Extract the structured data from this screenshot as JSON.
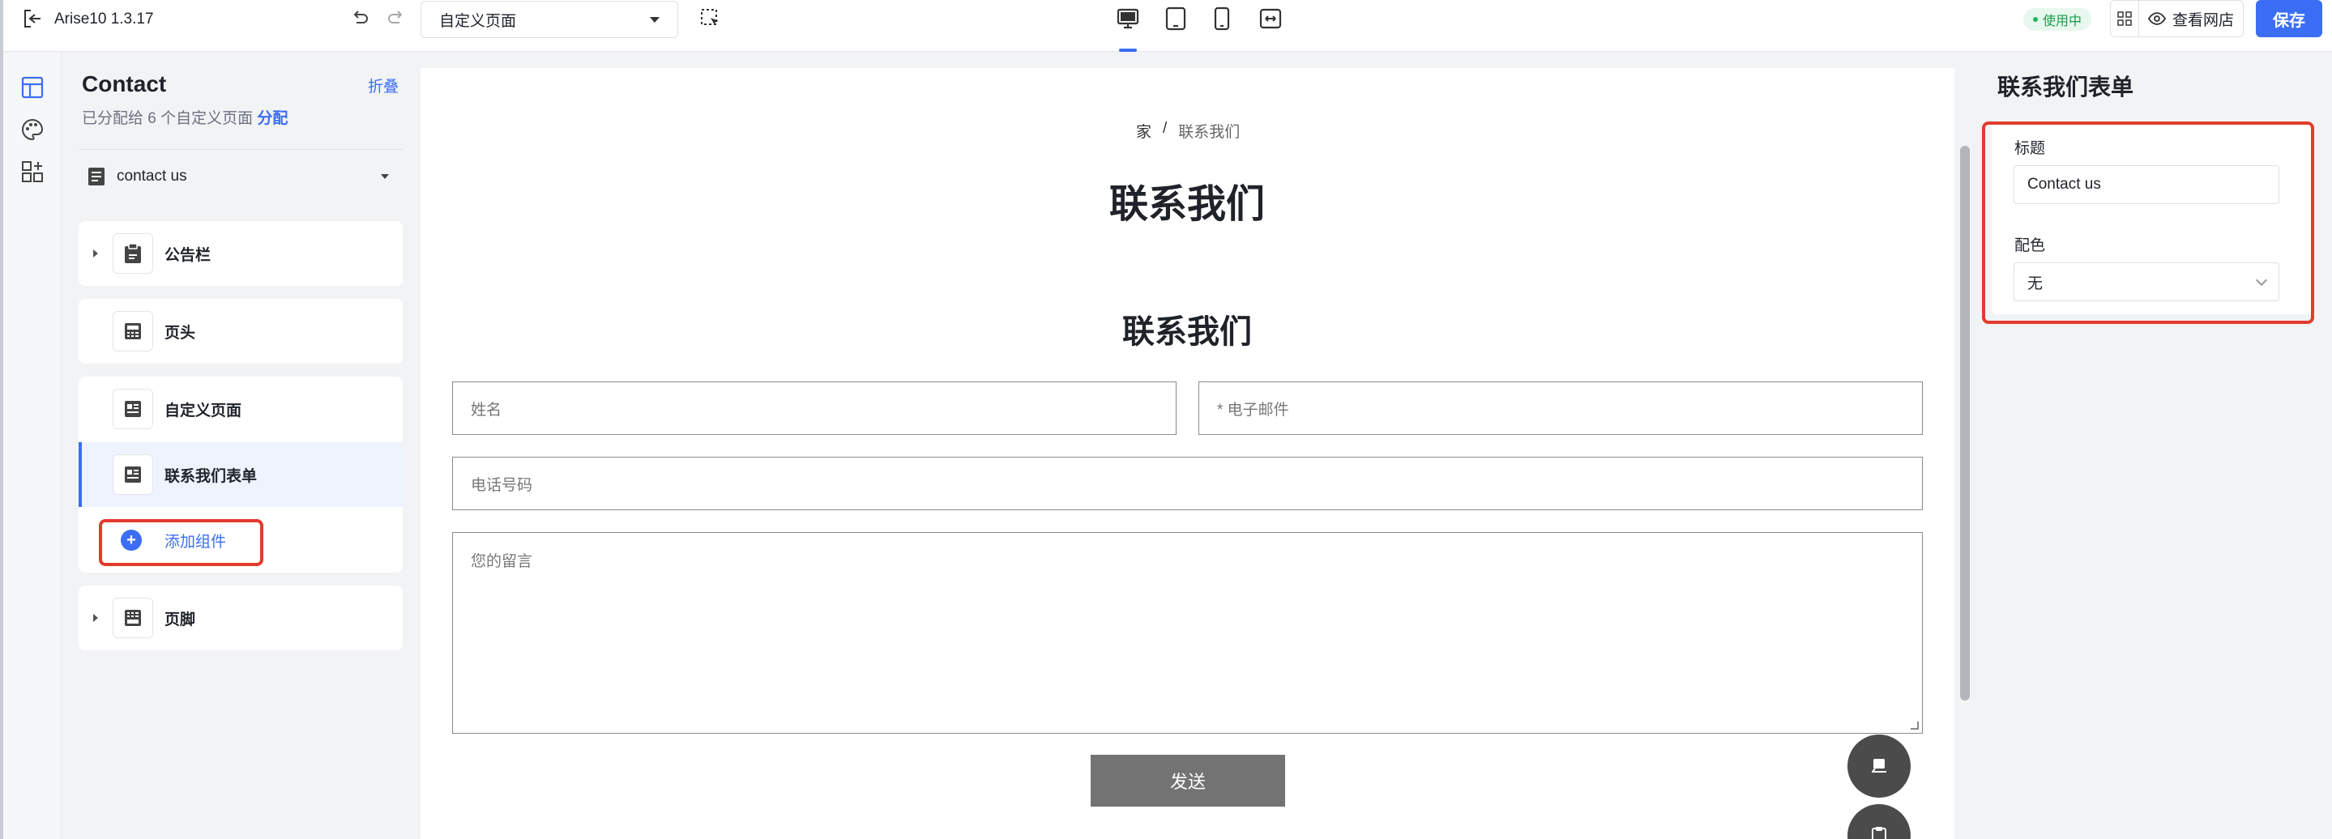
{
  "topbar": {
    "app_name": "Arise10 1.3.17",
    "page_select_value": "自定义页面",
    "status_badge": "使用中",
    "view_store_label": "查看网店",
    "save_label": "保存"
  },
  "left_panel": {
    "title": "Contact",
    "collapse_label": "折叠",
    "assigned_text": "已分配给 6 个自定义页面",
    "assign_link": "分配",
    "page_select_value": "contact us",
    "sections": [
      {
        "label": "公告栏",
        "icon": "clipboard-icon"
      },
      {
        "label": "页头",
        "icon": "header-icon"
      },
      {
        "label": "自定义页面",
        "icon": "page-card-icon"
      },
      {
        "label": "联系我们表单",
        "icon": "contact-form-icon"
      },
      {
        "label": "添加组件",
        "icon": "plus-circle-icon"
      },
      {
        "label": "页脚",
        "icon": "footer-icon"
      }
    ]
  },
  "canvas": {
    "breadcrumb_home": "家",
    "breadcrumb_sep": "/",
    "breadcrumb_current": "联系我们",
    "page_heading": "联系我们",
    "form_heading": "联系我们",
    "name_placeholder": "姓名",
    "email_placeholder": "* 电子邮件",
    "phone_placeholder": "电话号码",
    "message_placeholder": "您的留言",
    "send_label": "发送"
  },
  "right_panel": {
    "title": "联系我们表单",
    "title_field_label": "标题",
    "title_field_value": "Contact us",
    "color_field_label": "配色",
    "color_field_value": "无"
  },
  "colors": {
    "accent": "#3b6ef5",
    "highlight": "#e23b2e",
    "live_badge": "#1a9b4b",
    "send_button": "#737373"
  }
}
